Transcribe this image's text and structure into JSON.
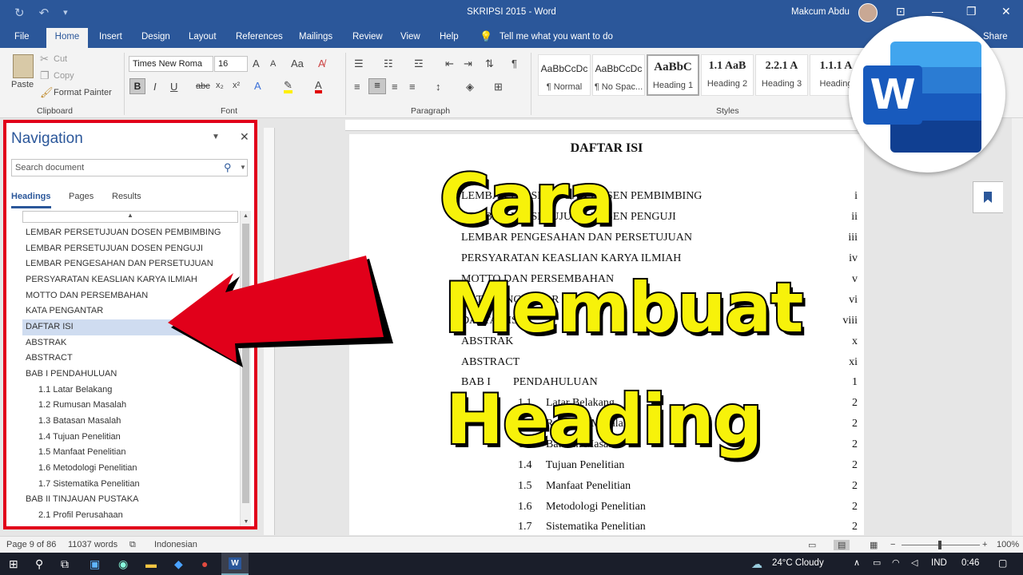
{
  "titlebar": {
    "title": "SKRIPSI 2015  -  Word",
    "user": "Makcum Abdu",
    "undo": "↶",
    "redo": "↷",
    "save": "↻",
    "minimize": "—",
    "restore": "❐",
    "close": "✕",
    "ribbon_options": "⊡",
    "customize": "▾"
  },
  "menu": {
    "file": "File",
    "home": "Home",
    "insert": "Insert",
    "design": "Design",
    "layout": "Layout",
    "references": "References",
    "mailings": "Mailings",
    "review": "Review",
    "view": "View",
    "help": "Help",
    "tellme": "Tell me what you want to do",
    "share": "Share"
  },
  "ribbon": {
    "clipboard": {
      "paste": "Paste",
      "cut": "Cut",
      "copy": "Copy",
      "format_painter": "Format Painter",
      "group": "Clipboard"
    },
    "font": {
      "name": "Times New Roma",
      "size": "16",
      "group": "Font",
      "grow": "A",
      "shrink": "A",
      "case": "Aa",
      "bold": "B",
      "italic": "I",
      "underline": "U",
      "strike": "abc",
      "sub": "x₂",
      "sup": "x²",
      "color": "A"
    },
    "paragraph": {
      "group": "Paragraph",
      "pilcrow": "¶"
    },
    "styles": {
      "group": "Styles",
      "items": [
        {
          "preview": "AaBbCcDc",
          "name": "¶ Normal"
        },
        {
          "preview": "AaBbCcDc",
          "name": "¶ No Spac..."
        },
        {
          "preview": "AaBbC",
          "name": "Heading 1"
        },
        {
          "preview": "1.1  AaB",
          "name": "Heading 2"
        },
        {
          "preview": "2.2.1  A",
          "name": "Heading 3"
        },
        {
          "preview": "1.1.1  A",
          "name": "Heading"
        }
      ]
    }
  },
  "navigation": {
    "title": "Navigation",
    "search_placeholder": "Search document",
    "tabs": [
      "Headings",
      "Pages",
      "Results"
    ],
    "items": [
      "LEMBAR PERSETUJUAN DOSEN PEMBIMBING",
      "LEMBAR PERSETUJUAN DOSEN PENGUJI",
      "LEMBAR PENGESAHAN DAN PERSETUJUAN",
      "PERSYARATAN KEASLIAN KARYA ILMIAH",
      "MOTTO DAN PERSEMBAHAN",
      "KATA PENGANTAR",
      "DAFTAR ISI",
      "ABSTRAK",
      "ABSTRACT",
      "BAB I PENDAHULUAN",
      "1.1 Latar Belakang",
      "1.2 Rumusan Masalah",
      "1.3 Batasan Masalah",
      "1.4 Tujuan Penelitian",
      "1.5 Manfaat Penelitian",
      "1.6 Metodologi Penelitian",
      "1.7 Sistematika Penelitian",
      "BAB II TINJAUAN PUSTAKA",
      "2.1 Profil Perusahaan"
    ],
    "selected": "DAFTAR ISI"
  },
  "document": {
    "title": "DAFTAR ISI",
    "toc": [
      {
        "label": "LEMBAR PERSETUJUAN DOSEN PEMBIMBING",
        "page": "i"
      },
      {
        "label": "LEMBAR PERSETUJUAN DOSEN PENGUJI",
        "page": "ii"
      },
      {
        "label": "LEMBAR PENGESAHAN DAN PERSETUJUAN",
        "page": "iii"
      },
      {
        "label": "PERSYARATAN KEASLIAN KARYA ILMIAH",
        "page": "iv"
      },
      {
        "label": "MOTTO DAN PERSEMBAHAN",
        "page": "v"
      },
      {
        "label": "KATA PENGANTAR",
        "page": "vi"
      },
      {
        "label": "DAFTAR ISI",
        "page": "viii"
      },
      {
        "label": "ABSTRAK",
        "page": "x"
      },
      {
        "label": "ABSTRACT",
        "page": "xi"
      },
      {
        "label": "BAB I        PENDAHULUAN",
        "page": "1"
      },
      {
        "label": "1.1     Latar Belakang",
        "page": "2"
      },
      {
        "label": "1.2     Rumusan Masalah",
        "page": "2"
      },
      {
        "label": "1.3     Batasan Masalah",
        "page": "2"
      },
      {
        "label": "1.4     Tujuan Penelitian",
        "page": "2"
      },
      {
        "label": "1.5     Manfaat Penelitian",
        "page": "2"
      },
      {
        "label": "1.6     Metodologi Penelitian",
        "page": "2"
      },
      {
        "label": "1.7     Sistematika Penelitian",
        "page": "2"
      }
    ]
  },
  "overlay": {
    "line1": "Cara",
    "line2": "Membuat",
    "line3": "Heading",
    "text_color": "#f7f20a",
    "arrow_color": "#e1001a"
  },
  "statusbar": {
    "page": "Page 9 of 86",
    "words": "11037 words",
    "language": "Indonesian",
    "zoom": "100%"
  },
  "taskbar": {
    "weather": "24°C  Cloudy",
    "lang": "IND",
    "time": "0:46"
  },
  "colors": {
    "word_blue": "#2b579a",
    "highlight": "#e1001a"
  }
}
